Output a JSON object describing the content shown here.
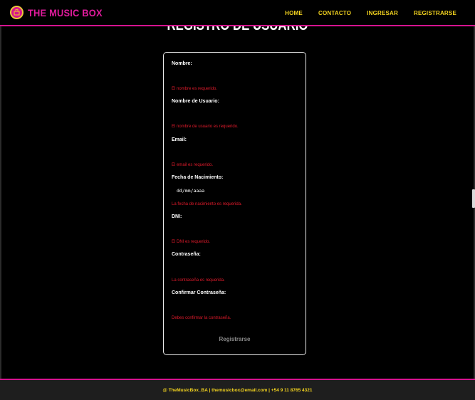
{
  "header": {
    "brand": "THE MUSIC BOX",
    "logo_icon": "music-box-icon",
    "nav": [
      "HOME",
      "CONTACTO",
      "INGRESAR",
      "REGISTRARSE"
    ]
  },
  "title": "REGISTRO DE USUARIO",
  "form": {
    "fields": [
      {
        "label": "Nombre:",
        "value": "",
        "error": "El nombre es requerido."
      },
      {
        "label": "Nombre de Usuario:",
        "value": "",
        "error": "El nombre de usuario es requerido."
      },
      {
        "label": "Email:",
        "value": "",
        "error": "El email es requerido."
      },
      {
        "label": "Fecha de Nacimiento:",
        "value": "dd/mm/aaaa",
        "error": "La fecha de nacimiento es requerida."
      },
      {
        "label": "DNI:",
        "value": "",
        "error": "El DNI es requerido."
      },
      {
        "label": "Contraseña:",
        "value": "",
        "error": "La contraseña es requerida."
      },
      {
        "label": "Confirmar Contraseña:",
        "value": "",
        "error": "Debes confirmar la contraseña."
      }
    ],
    "submit_label": "Registrarse"
  },
  "footer": {
    "text": "@ TheMusicBox_BA | themusicbox@email.com | +54 9 11 8765 4321"
  },
  "colors": {
    "accent_pink": "#d6138f",
    "nav_yellow": "#f2d21f",
    "error_red": "#e01a2b"
  }
}
